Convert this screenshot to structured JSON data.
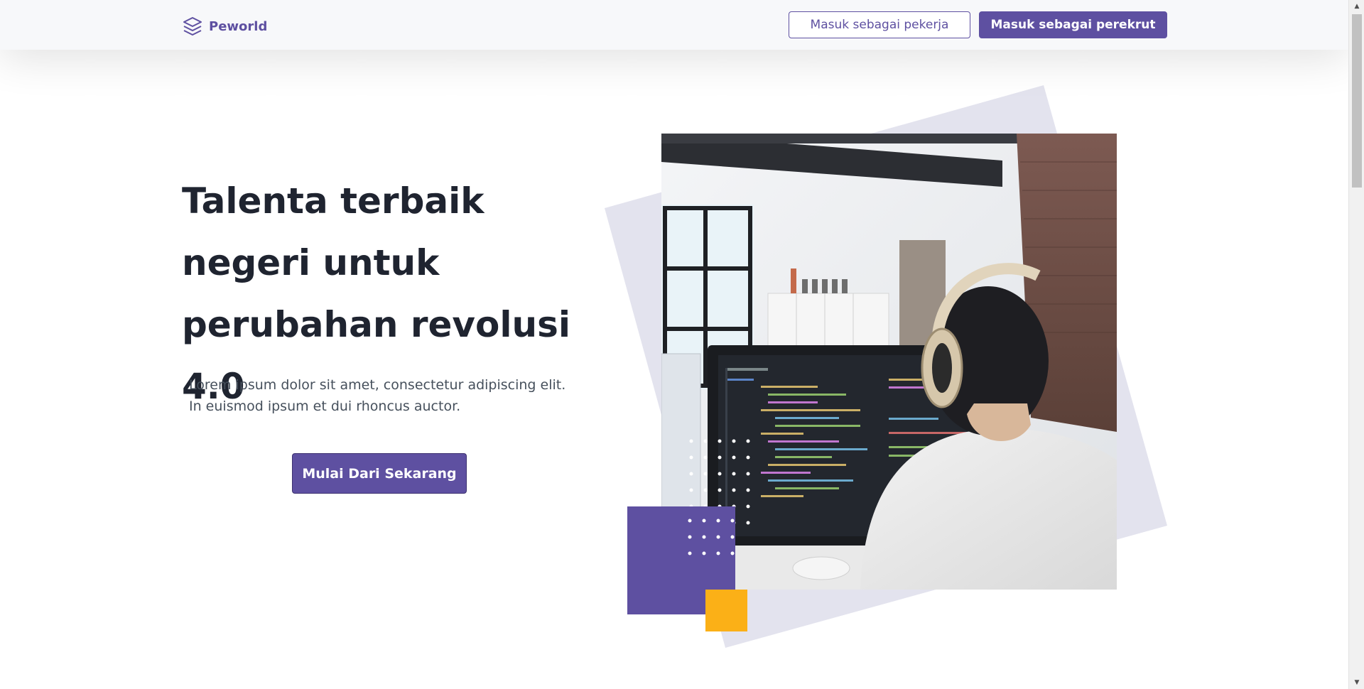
{
  "navbar": {
    "brand": "Peworld",
    "login_worker": "Masuk sebagai pekerja",
    "login_recruiter": "Masuk sebagai perekrut"
  },
  "hero": {
    "title": "Talenta terbaik negeri untuk perubahan revolusi 4.0",
    "description_line1": "Lorem ipsum dolor sit amet, consectetur adipiscing elit.",
    "description_line2": "In euismod ipsum et dui rhoncus auctor.",
    "cta": "Mulai Dari Sekarang"
  },
  "colors": {
    "primary": "#5e50a1",
    "accent": "#fbb017",
    "decor": "#e3e3ee"
  }
}
